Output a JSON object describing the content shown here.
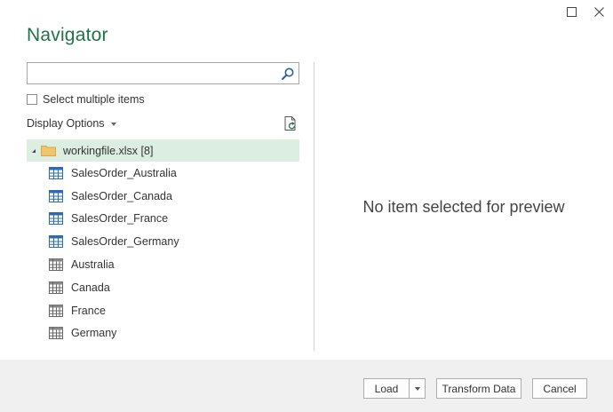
{
  "dialog": {
    "title": "Navigator"
  },
  "search": {
    "value": "",
    "placeholder": ""
  },
  "options": {
    "select_multiple_label": "Select multiple items",
    "select_multiple_checked": false,
    "display_options_label": "Display Options"
  },
  "tree": {
    "root_label": "workingfile.xlsx [8]",
    "items": [
      {
        "label": "SalesOrder_Australia",
        "icon": "table-icon"
      },
      {
        "label": "SalesOrder_Canada",
        "icon": "table-icon"
      },
      {
        "label": "SalesOrder_France",
        "icon": "table-icon"
      },
      {
        "label": "SalesOrder_Germany",
        "icon": "table-icon"
      },
      {
        "label": "Australia",
        "icon": "sheet-icon"
      },
      {
        "label": "Canada",
        "icon": "sheet-icon"
      },
      {
        "label": "France",
        "icon": "sheet-icon"
      },
      {
        "label": "Germany",
        "icon": "sheet-icon"
      }
    ]
  },
  "preview": {
    "message": "No item selected for preview"
  },
  "footer": {
    "load_label": "Load",
    "transform_label": "Transform Data",
    "cancel_label": "Cancel"
  },
  "colors": {
    "title": "#217346",
    "selected_row": "#dbeee1",
    "table_icon": "#2b6cb0",
    "folder": "#f0c36d"
  }
}
